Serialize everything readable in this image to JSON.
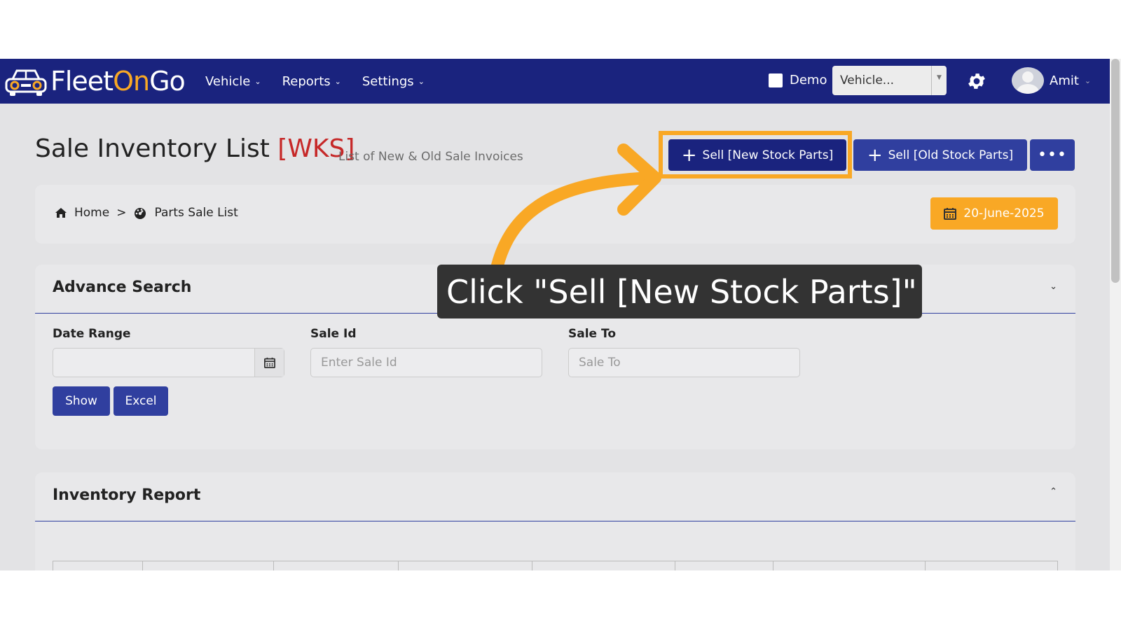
{
  "brand": {
    "name_prefix": "Fleet",
    "name_highlight": "On",
    "name_suffix": "Go"
  },
  "nav": {
    "menu": [
      {
        "label": "Vehicle"
      },
      {
        "label": "Reports"
      },
      {
        "label": "Settings"
      }
    ],
    "demo_label": "Demo",
    "vehicle_select_value": "Vehicle...",
    "user_name": "Amit"
  },
  "header": {
    "title": "Sale Inventory List",
    "title_tag": "[WKS]",
    "subtitle": "List of New & Old Sale Invoices",
    "btn_new_stock": "Sell [New Stock Parts]",
    "btn_old_stock": "Sell [Old Stock Parts]",
    "btn_more": "•••"
  },
  "breadcrumb": {
    "home": "Home",
    "separator": ">",
    "current": "Parts Sale List",
    "date": "20-June-2025"
  },
  "advance_search": {
    "title": "Advance Search",
    "date_range_label": "Date Range",
    "sale_id_label": "Sale Id",
    "sale_id_placeholder": "Enter Sale Id",
    "sale_to_label": "Sale To",
    "sale_to_placeholder": "Sale To",
    "show_button": "Show",
    "excel_button": "Excel"
  },
  "inventory_report": {
    "title": "Inventory Report"
  },
  "tooltip": {
    "text": "Click \"Sell [New Stock Parts]\""
  },
  "colors": {
    "navbar": "#1a237e",
    "accent": "#f9a825",
    "button": "#303f9f",
    "title_tag": "#c62828"
  }
}
